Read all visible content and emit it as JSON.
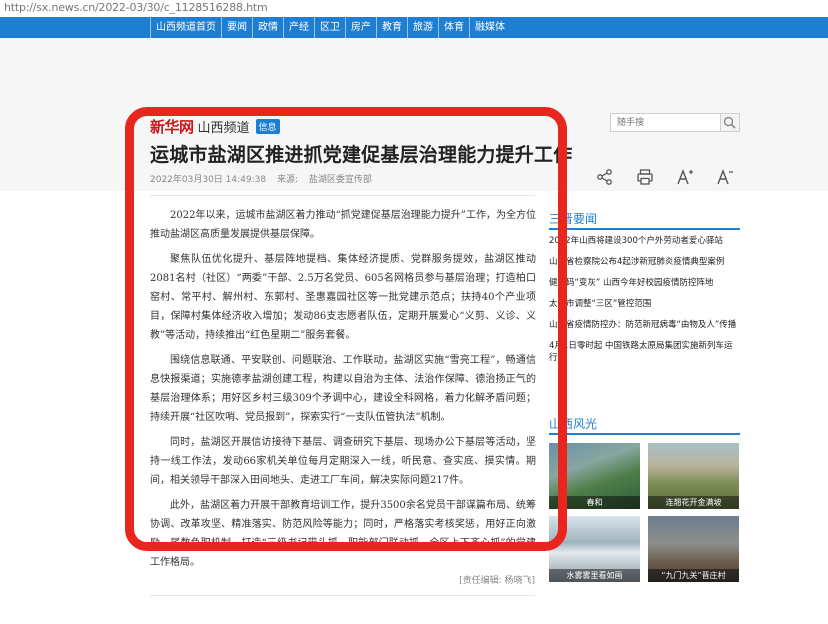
{
  "browser": {
    "url": "http://sx.news.cn/2022-03/30/c_1128516288.htm"
  },
  "nav": {
    "items": [
      "山西频道首页",
      "要闻",
      "政情",
      "产经",
      "区卫",
      "房产",
      "教育",
      "旅游",
      "体育",
      "融媒体"
    ]
  },
  "header": {
    "logo": "新华网",
    "channel": "山西频道",
    "tag": "信息",
    "search_placeholder": "随手搜"
  },
  "article": {
    "title": "运城市盐湖区推进抓党建促基层治理能力提升工作",
    "date": "2022年03月30日 14:49:38",
    "source_label": "来源:",
    "source": "盐湖区委宣传部",
    "paragraphs": [
      "2022年以来，运城市盐湖区着力推动“抓党建促基层治理能力提升”工作，为全方位推动盐湖区高质量发展提供基层保障。",
      "聚焦队伍优化提升、基层阵地提档、集体经济提质、党群服务提效，盐湖区推动2081名村（社区）“两委”干部、2.5万名党员、605名网格员参与基层治理；打造柏口窑村、常平村、解州村、东郭村、圣惠嘉园社区等一批党建示范点；扶持40个产业项目，保障村集体经济收入增加；发动86支志愿者队伍，定期开展爱心“义剪、义诊、义教”等活动，持续推出“红色星期二”服务套餐。",
      "围绕信息联通、平安联创、问题联治、工作联动，盐湖区实施“雪亮工程”，畅通信息快报渠道；实施德孝盐湖创建工程，构建以自治为主体、法治作保障、德治扬正气的基层治理体系；用好区乡村三级309个矛调中心，建设全科网格，着力化解矛盾问题；持续开展“社区吹哨、党员报到”，探索实行“一支队伍管执法”机制。",
      "同时，盐湖区开展信访接待下基层、调查研究下基层、现场办公下基层等活动，坚持一线工作法，发动66家机关单位每月定期深入一线，听民意、查实底、摸实情。期间，相关领导干部深入田间地头、走进工厂车间，解决实际问题217件。",
      "此外，盐湖区着力开展干部教育培训工作，提升3500余名党员干部谋篇布局、统筹协调、改革攻坚、精准落实、防范风险等能力；同时，严格落实考核奖惩，用好正向激励、尾数负职机制，打造“三级书记带头抓、职能部门联动抓、全区上下齐心抓”的党建工作格局。"
    ],
    "editor": "[责任编辑: 杨晓飞]"
  },
  "sidebar": {
    "news_title": "三晋要闻",
    "news": [
      "2022年山西将建设300个户外劳动者爱心驿站",
      "山西省检察院公布4起涉新冠肺炎疫情典型案例",
      "健康码“变灰” 山西今年好校园疫情防控阵地",
      "太原市调整“三区”管控范围",
      "山西省疫情防控办：防范新冠病毒“由物及人”传播",
      "4月1日零时起 中国铁路太原局集团实施新列车运行图"
    ],
    "photos_title": "山西风光",
    "photos": [
      "春和",
      "连翘花开金满坡",
      "水雾雾里看如画",
      "“九门九关”晋庄村"
    ]
  },
  "colors": {
    "nav_blue": "#1e7fd2",
    "logo_red": "#c8161d",
    "highlight_red": "#e8261d"
  },
  "icons": [
    "share-icon",
    "print-icon",
    "font-increase-icon",
    "font-decrease-icon",
    "search-icon"
  ]
}
